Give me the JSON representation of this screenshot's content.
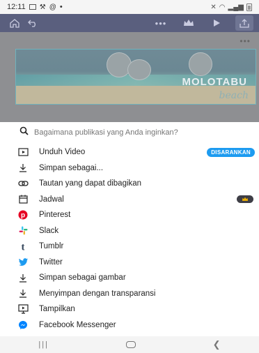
{
  "status_bar": {
    "time": "12:11",
    "extra": "•"
  },
  "design": {
    "title": "MOLOTABU",
    "subtitle": "beach"
  },
  "search": {
    "placeholder": "Bagaimana publikasi yang Anda inginkan?"
  },
  "options": [
    {
      "label": "Unduh Video",
      "icon": "video-icon",
      "badge": "DISARANKAN"
    },
    {
      "label": "Simpan sebagai...",
      "icon": "download-icon"
    },
    {
      "label": "Tautan yang dapat dibagikan",
      "icon": "link-icon"
    },
    {
      "label": "Jadwal",
      "icon": "calendar-icon",
      "pro": true
    },
    {
      "label": "Pinterest",
      "icon": "pinterest-icon",
      "color": "#e60023"
    },
    {
      "label": "Slack",
      "icon": "slack-icon"
    },
    {
      "label": "Tumblr",
      "icon": "tumblr-icon",
      "color": "#35465c"
    },
    {
      "label": "Twitter",
      "icon": "twitter-icon",
      "color": "#1d9bf0"
    },
    {
      "label": "Simpan sebagai gambar",
      "icon": "download-icon"
    },
    {
      "label": "Menyimpan dengan transparansi",
      "icon": "download-icon"
    },
    {
      "label": "Tampilkan",
      "icon": "present-icon"
    },
    {
      "label": "Facebook Messenger",
      "icon": "messenger-icon",
      "color": "#0084ff"
    }
  ],
  "colors": {
    "toolbar": "#5a5f7e",
    "accent": "#1d9bf0"
  }
}
